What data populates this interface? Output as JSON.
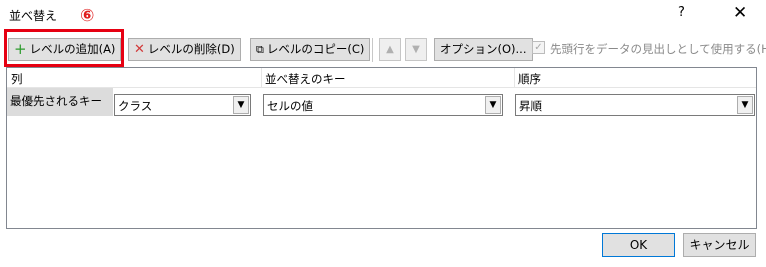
{
  "window": {
    "title": "並べ替え",
    "help": "?",
    "close": "✕"
  },
  "annotation": {
    "marker": "⑥"
  },
  "toolbar": {
    "add_level": "レベルの追加(A)",
    "delete_level": "レベルの削除(D)",
    "copy_level": "レベルのコピー(C)",
    "move_up": "▲",
    "move_down": "▼",
    "options": "オプション(O)...",
    "header_checkbox_label": "先頭行をデータの見出しとして使用する(H)",
    "header_checkbox_checked": "✓"
  },
  "grid": {
    "headers": {
      "column": "列",
      "sort_on": "並べ替えのキー",
      "order": "順序"
    },
    "rows": [
      {
        "label": "最優先されるキー",
        "column": "クラス",
        "sort_on": "セルの値",
        "order": "昇順"
      }
    ]
  },
  "footer": {
    "ok": "OK",
    "cancel": "キャンセル"
  },
  "colors": {
    "highlight": "#e60012",
    "add_icon": "#2c9a2c",
    "delete_icon": "#d23a3a"
  }
}
